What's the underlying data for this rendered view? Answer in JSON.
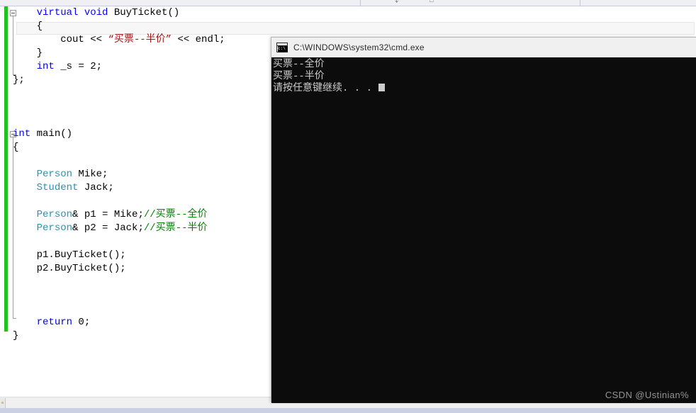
{
  "editor": {
    "change_bar_color": "#1fc21f",
    "syntax_colors": {
      "keyword": "#0000ff",
      "type": "#2b91af",
      "string": "#a31515",
      "comment": "#008000",
      "plain": "#000000"
    },
    "lines": [
      {
        "indent": 4,
        "tokens": [
          {
            "t": "virtual",
            "c": "kw"
          },
          {
            "t": " ",
            "c": "plain"
          },
          {
            "t": "void",
            "c": "kw"
          },
          {
            "t": " BuyTicket()",
            "c": "plain"
          }
        ]
      },
      {
        "indent": 4,
        "tokens": [
          {
            "t": "{",
            "c": "plain"
          }
        ]
      },
      {
        "indent": 8,
        "tokens": [
          {
            "t": "cout << ",
            "c": "plain"
          },
          {
            "t": "“买票--半价”",
            "c": "str"
          },
          {
            "t": " << endl;",
            "c": "plain"
          }
        ]
      },
      {
        "indent": 4,
        "tokens": [
          {
            "t": "}",
            "c": "plain"
          }
        ]
      },
      {
        "indent": 4,
        "tokens": [
          {
            "t": "int",
            "c": "kw"
          },
          {
            "t": " _s = 2;",
            "c": "plain"
          }
        ]
      },
      {
        "indent": 0,
        "tokens": [
          {
            "t": "};",
            "c": "plain"
          }
        ]
      },
      {
        "indent": 0,
        "tokens": []
      },
      {
        "indent": 0,
        "tokens": []
      },
      {
        "indent": 0,
        "tokens": []
      },
      {
        "indent": 0,
        "tokens": [
          {
            "t": "int",
            "c": "kw"
          },
          {
            "t": " main()",
            "c": "plain"
          }
        ]
      },
      {
        "indent": 0,
        "tokens": [
          {
            "t": "{",
            "c": "plain"
          }
        ]
      },
      {
        "indent": 0,
        "tokens": []
      },
      {
        "indent": 4,
        "tokens": [
          {
            "t": "Person",
            "c": "type"
          },
          {
            "t": " Mike;",
            "c": "plain"
          }
        ]
      },
      {
        "indent": 4,
        "tokens": [
          {
            "t": "Student",
            "c": "type"
          },
          {
            "t": " Jack;",
            "c": "plain"
          }
        ]
      },
      {
        "indent": 0,
        "tokens": []
      },
      {
        "indent": 4,
        "tokens": [
          {
            "t": "Person",
            "c": "type"
          },
          {
            "t": "& p1 = Mike;",
            "c": "plain"
          },
          {
            "t": "//买票--全价",
            "c": "cmt"
          }
        ]
      },
      {
        "indent": 4,
        "tokens": [
          {
            "t": "Person",
            "c": "type"
          },
          {
            "t": "& p2 = Jack;",
            "c": "plain"
          },
          {
            "t": "//买票--半价",
            "c": "cmt"
          }
        ]
      },
      {
        "indent": 0,
        "tokens": []
      },
      {
        "indent": 4,
        "tokens": [
          {
            "t": "p1.BuyTicket();",
            "c": "plain"
          }
        ]
      },
      {
        "indent": 4,
        "tokens": [
          {
            "t": "p2.BuyTicket();",
            "c": "plain"
          }
        ]
      },
      {
        "indent": 0,
        "tokens": []
      },
      {
        "indent": 0,
        "tokens": []
      },
      {
        "indent": 0,
        "tokens": []
      },
      {
        "indent": 4,
        "tokens": [
          {
            "t": "return",
            "c": "kw"
          },
          {
            "t": " 0;",
            "c": "plain"
          }
        ]
      },
      {
        "indent": 0,
        "tokens": [
          {
            "t": "}",
            "c": "plain"
          }
        ]
      }
    ]
  },
  "console": {
    "title": "C:\\WINDOWS\\system32\\cmd.exe",
    "icon": "cmd-icon",
    "background": "#0c0c0c",
    "foreground": "#cccccc",
    "output": [
      "买票--全价",
      "买票--半价",
      "请按任意键继续. . ."
    ]
  },
  "watermark": {
    "text": "CSDN @Ustinian%"
  },
  "top_strip": {
    "glyph_left": "⤵",
    "glyph_right": "□"
  }
}
